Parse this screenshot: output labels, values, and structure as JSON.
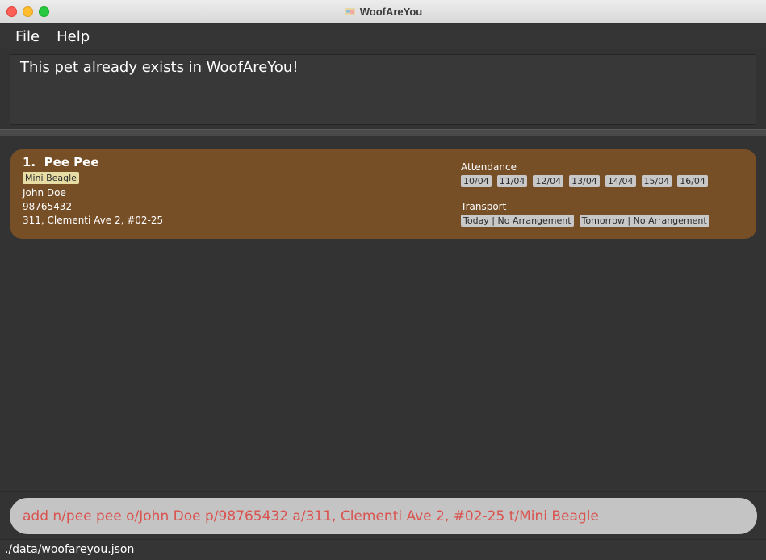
{
  "window": {
    "title": "WoofAreYou"
  },
  "menu": {
    "file": "File",
    "help": "Help"
  },
  "result": {
    "message": "This pet already exists in WoofAreYou!"
  },
  "pets": [
    {
      "index": "1.",
      "name": "Pee Pee",
      "tag": "Mini Beagle",
      "owner": "John Doe",
      "phone": "98765432",
      "address": "311, Clementi Ave 2, #02-25",
      "attendance_label": "Attendance",
      "attendance_dates": [
        "10/04",
        "11/04",
        "12/04",
        "13/04",
        "14/04",
        "15/04",
        "16/04"
      ],
      "transport_label": "Transport",
      "transport": [
        "Today | No Arrangement",
        "Tomorrow | No Arrangement"
      ]
    }
  ],
  "command": {
    "value": "add n/pee pee o/John Doe p/98765432 a/311, Clementi Ave 2, #02-25 t/Mini Beagle"
  },
  "status": {
    "path": "./data/woofareyou.json"
  },
  "colors": {
    "card": "#774f27",
    "command_text": "#d9534f",
    "background": "#333333"
  }
}
